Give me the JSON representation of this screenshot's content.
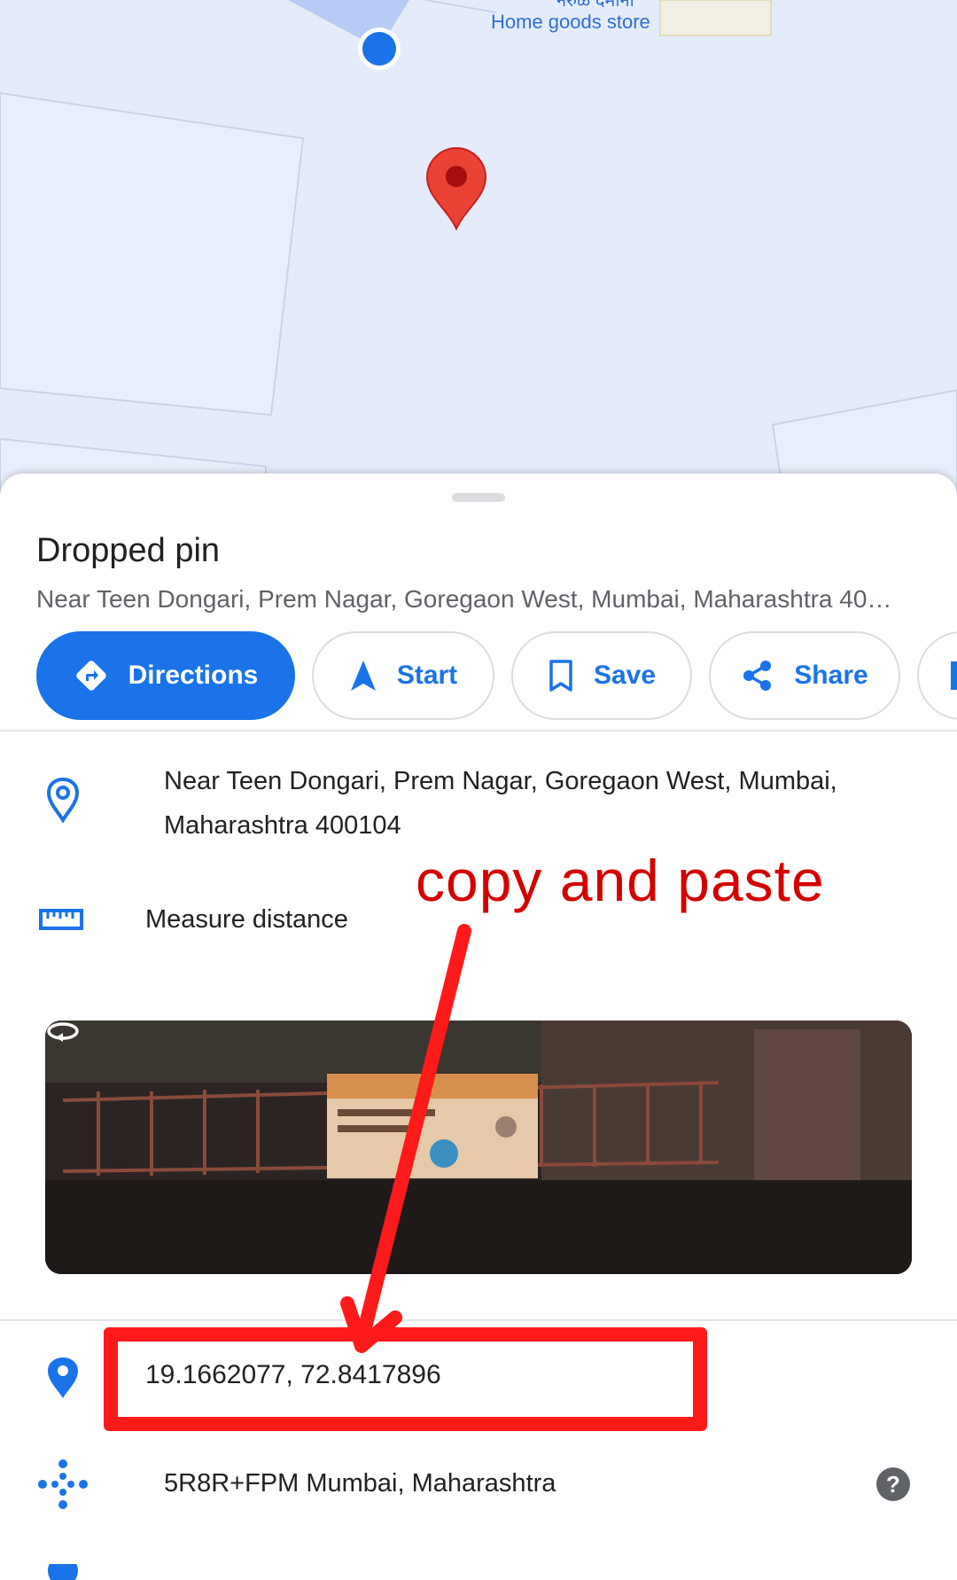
{
  "map": {
    "store_label_top": "नेरुळ दमानी",
    "store_label": "Home goods store",
    "user_location_icon": "blue-dot",
    "pin_icon": "red-map-pin"
  },
  "sheet": {
    "title": "Dropped pin",
    "subtitle": "Near Teen Dongari, Prem Nagar, Goregaon West, Mumbai, Maharashtra 40…"
  },
  "actions": [
    {
      "label": "Directions",
      "icon": "directions-icon"
    },
    {
      "label": "Start",
      "icon": "navigation-arrow-icon"
    },
    {
      "label": "Save",
      "icon": "bookmark-icon"
    },
    {
      "label": "Share",
      "icon": "share-icon"
    }
  ],
  "details": {
    "address": "Near Teen Dongari, Prem Nagar, Goregaon West, Mumbai, Maharashtra 400104",
    "measure_distance": "Measure distance",
    "coordinates": "19.1662077, 72.8417896",
    "plus_code": "5R8R+FPM Mumbai, Maharashtra",
    "help": "?"
  },
  "annotation": {
    "text": "copy and paste",
    "color": "#ff1a1a"
  },
  "colors": {
    "accent": "#1a73e8",
    "pin": "#ea4335",
    "map_bg": "#e4ecfb"
  }
}
